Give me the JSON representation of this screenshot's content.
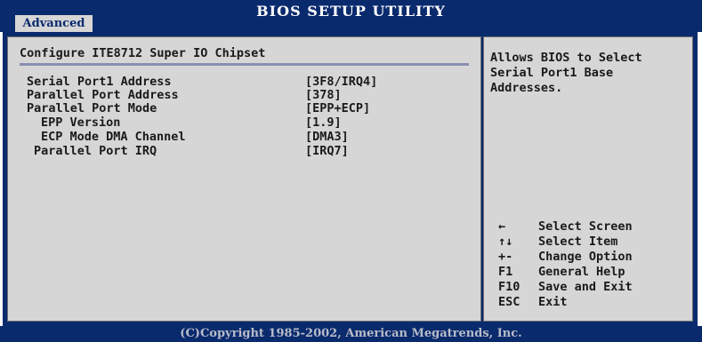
{
  "header": {
    "title": "BIOS SETUP UTILITY",
    "active_tab": "Advanced"
  },
  "main": {
    "heading": "Configure ITE8712 Super IO Chipset",
    "settings": [
      {
        "label": "Serial Port1 Address",
        "value": "[3F8/IRQ4]"
      },
      {
        "label": "Parallel Port Address",
        "value": "[378]"
      },
      {
        "label": "Parallel Port Mode",
        "value": "[EPP+ECP]"
      },
      {
        "label": "EPP Version",
        "value": "[1.9]"
      },
      {
        "label": "ECP Mode DMA Channel",
        "value": "[DMA3]"
      },
      {
        "label": "Parallel Port IRQ",
        "value": "[IRQ7]"
      }
    ]
  },
  "help": {
    "lines": [
      "Allows BIOS to Select",
      "Serial Port1 Base",
      "Addresses."
    ]
  },
  "keys": [
    {
      "key": "←",
      "desc": "Select Screen"
    },
    {
      "key": "↑↓",
      "desc": "Select Item"
    },
    {
      "key": "+-",
      "desc": "Change Option"
    },
    {
      "key": "F1",
      "desc": "General Help"
    },
    {
      "key": "F10",
      "desc": "Save and Exit"
    },
    {
      "key": "ESC",
      "desc": "Exit"
    }
  ],
  "footer": {
    "copyright": "(C)Copyright 1985-2002, American Megatrends, Inc."
  },
  "colors": {
    "bar_blue": "#0a2a6e",
    "panel_gray": "#d6d6d6"
  }
}
